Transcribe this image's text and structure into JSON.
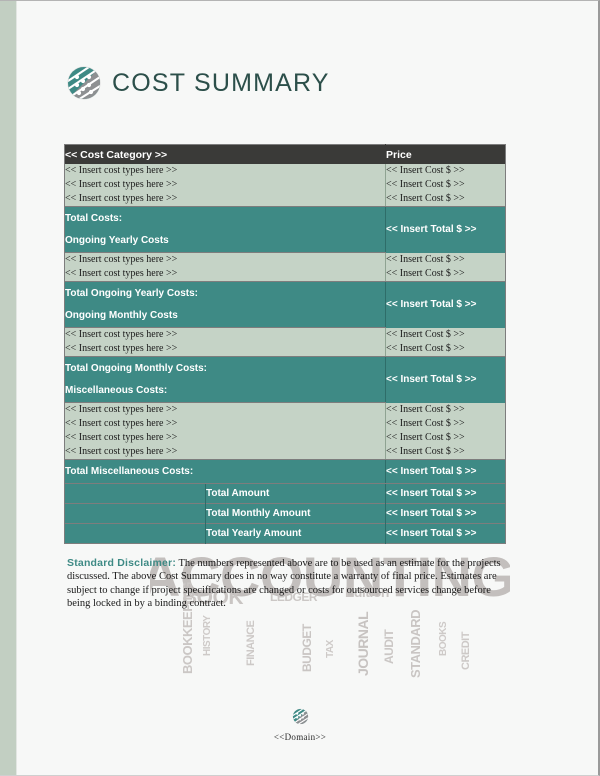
{
  "document": {
    "title": "COST SUMMARY",
    "logo_icon": "striped-sphere-logo-icon"
  },
  "table": {
    "columns": [
      "<< Cost Category >>",
      "Price"
    ],
    "sections": [
      {
        "type": "items",
        "rows": [
          {
            "category": "<< Insert cost types here >>",
            "price": "<< Insert Cost $ >>"
          },
          {
            "category": "<< Insert cost types here >>",
            "price": "<< Insert Cost $ >>"
          },
          {
            "category": "<< Insert cost types here >>",
            "price": "<< Insert Cost $ >>"
          }
        ]
      },
      {
        "type": "total",
        "total_label": "Total Costs:",
        "next_label": "Ongoing Yearly Costs",
        "price": "<< Insert Total $ >>"
      },
      {
        "type": "items",
        "rows": [
          {
            "category": "<< Insert cost types here >>",
            "price": "<< Insert Cost $ >>"
          },
          {
            "category": "<< Insert cost types here >>",
            "price": "<< Insert Cost $ >>"
          }
        ]
      },
      {
        "type": "total",
        "total_label": "Total Ongoing Yearly Costs:",
        "next_label": "Ongoing Monthly Costs",
        "price": "<< Insert Total $ >>"
      },
      {
        "type": "items",
        "rows": [
          {
            "category": "<< Insert cost types here >>",
            "price": "<< Insert Cost $ >>"
          },
          {
            "category": "<< Insert cost types here >>",
            "price": "<< Insert Cost $ >>"
          }
        ]
      },
      {
        "type": "total",
        "total_label": "Total Ongoing Monthly Costs:",
        "next_label": "Miscellaneous Costs:",
        "price": "<< Insert Total $ >>"
      },
      {
        "type": "items",
        "rows": [
          {
            "category": "<< Insert cost types here >>",
            "price": "<< Insert Cost $ >>"
          },
          {
            "category": "<< Insert cost types here >>",
            "price": "<< Insert Cost $ >>"
          },
          {
            "category": "<< Insert cost types here >>",
            "price": "<< Insert Cost $ >>"
          },
          {
            "category": "<< Insert cost types here >>",
            "price": "<< Insert Cost $ >>"
          }
        ]
      },
      {
        "type": "total_single",
        "total_label": "Total Miscellaneous Costs:",
        "price": "<< Insert Total $ >>"
      }
    ],
    "summary_rows": [
      {
        "blank": "",
        "label": "Total Amount",
        "price": "<< Insert Total $ >>"
      },
      {
        "blank": "",
        "label": "Total Monthly Amount",
        "price": "<< Insert Total $ >>"
      },
      {
        "blank": "",
        "label": "Total Yearly Amount",
        "price": "<< Insert Total $ >>"
      }
    ]
  },
  "disclaimer": {
    "label": "Standard Disclaimer:",
    "body": " The numbers represented above are to be used as an estimate for the projects discussed. The above Cost Summary does in no way constitute a warranty of final price.  Estimates are subject to change if project specifications are changed or costs for outsourced services change before being locked in by a binding contract."
  },
  "footer": {
    "domain": "<<Domain>>",
    "logo_icon": "striped-sphere-logo-icon"
  },
  "watermark": {
    "words": [
      "ACCOUNTING",
      "BOOKKEEPING",
      "HISTORY",
      "FINANCE",
      "LEDGER",
      "STANDARD",
      "AUDIT",
      "BOOKS",
      "TAX",
      "BUDGET"
    ]
  },
  "colors": {
    "teal": "#3e8a85",
    "header_dark": "#3a3a38",
    "row_light": "#c5d3c6",
    "title_text": "#2c4f4a",
    "left_stripe": "#c2cfc2"
  }
}
